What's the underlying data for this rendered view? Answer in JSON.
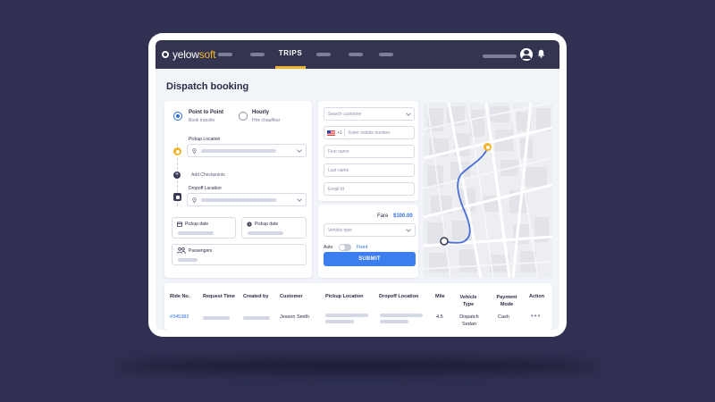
{
  "brand": {
    "prefix": "yelow",
    "suffix": "soft",
    "accent": "#f0b429",
    "nav_bg": "#33344f",
    "primary": "#3b7ef0"
  },
  "nav": {
    "active_tab": "TRIPS"
  },
  "page": {
    "title": "Dispatch booking"
  },
  "booking": {
    "trip_types": [
      {
        "label": "Point to Point",
        "sub": "Book transfer",
        "selected": true
      },
      {
        "label": "Hourly",
        "sub": "Hire chauffeur",
        "selected": false
      }
    ],
    "pickup_location_label": "Pickup Location",
    "add_checkpoints": "Add Checkpoints",
    "dropoff_location_label": "Dropoff Location",
    "pickup_date_label": "Pickup date",
    "pickup_time_label": "Pickup date",
    "passengers_label": "Passengers"
  },
  "customer": {
    "search_placeholder": "Search customer",
    "country_code": "+1",
    "mobile_placeholder": "Enter mobile number",
    "first_name_placeholder": "First name",
    "last_name_placeholder": "Last name",
    "email_placeholder": "Email Id"
  },
  "fare": {
    "label": "Fare",
    "amount": "$100.00",
    "vehicle_type_placeholder": "Vehicle type",
    "mode_auto": "Auto",
    "mode_fixed": "Fixed",
    "submit_label": "SUBMIT"
  },
  "table": {
    "headers": [
      "Ride No.",
      "Request Time",
      "Created by",
      "Customer",
      "Pickup Location",
      "Dropoff Location",
      "Mile",
      "Vehicle Type",
      "Payment Mode",
      "Action"
    ],
    "rows": [
      {
        "ride_no": "#345382",
        "customer": "Jesson Smith",
        "mile": "4.5",
        "vehicle_type": "Dispatch Sedan",
        "payment": "Cash",
        "action": "•••"
      }
    ]
  }
}
